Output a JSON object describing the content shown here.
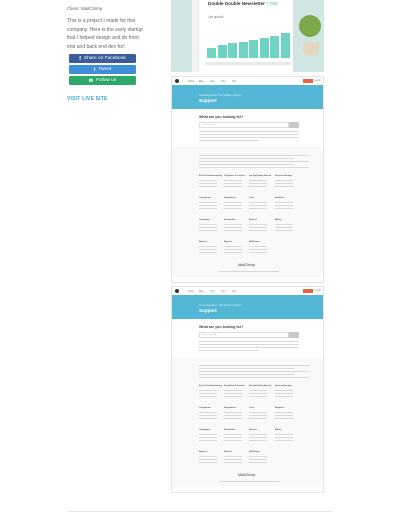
{
  "project": {
    "client_line": "Client: MailChimp",
    "description": "This is a project I made for this company. Here is the early startup that I helped design and do front end and back end dev for!",
    "live_label": "VISIT LIVE SITE"
  },
  "share": {
    "facebook": {
      "icon": "f",
      "label": "Share on Facebook"
    },
    "twitter": {
      "icon": "t",
      "label": "Tweet"
    },
    "follow": {
      "icon": "✉",
      "label": "Follow us"
    }
  },
  "hero": {
    "title": "Double Double Newsletter",
    "title_tag": "7,000",
    "subtitle": "List growth",
    "bars": [
      0.35,
      0.45,
      0.5,
      0.55,
      0.6,
      0.68,
      0.75,
      0.85
    ]
  },
  "support_page": {
    "nav": [
      "Home",
      "Blog",
      "Help",
      "Tips",
      "API"
    ],
    "nav_active": "Help",
    "login": "Log In",
    "crumbs": "Knowledge Base / Get Started / Support",
    "heading": "Support",
    "question": "What are you looking for?",
    "search_placeholder": "Search the KB",
    "columns": [
      [
        "Errors/Troubleshooting",
        "Compliance",
        "Campaigns",
        "Reports"
      ],
      [
        "Templates & Content",
        "Integrations",
        "Automation",
        "Reports"
      ],
      [
        "Set Up/Getting Started",
        "Lists",
        "Reports",
        "MailChimp"
      ],
      [
        "Account Settings",
        "Analytics",
        "Billing",
        ""
      ]
    ],
    "footer_logo": "MailChimp"
  }
}
